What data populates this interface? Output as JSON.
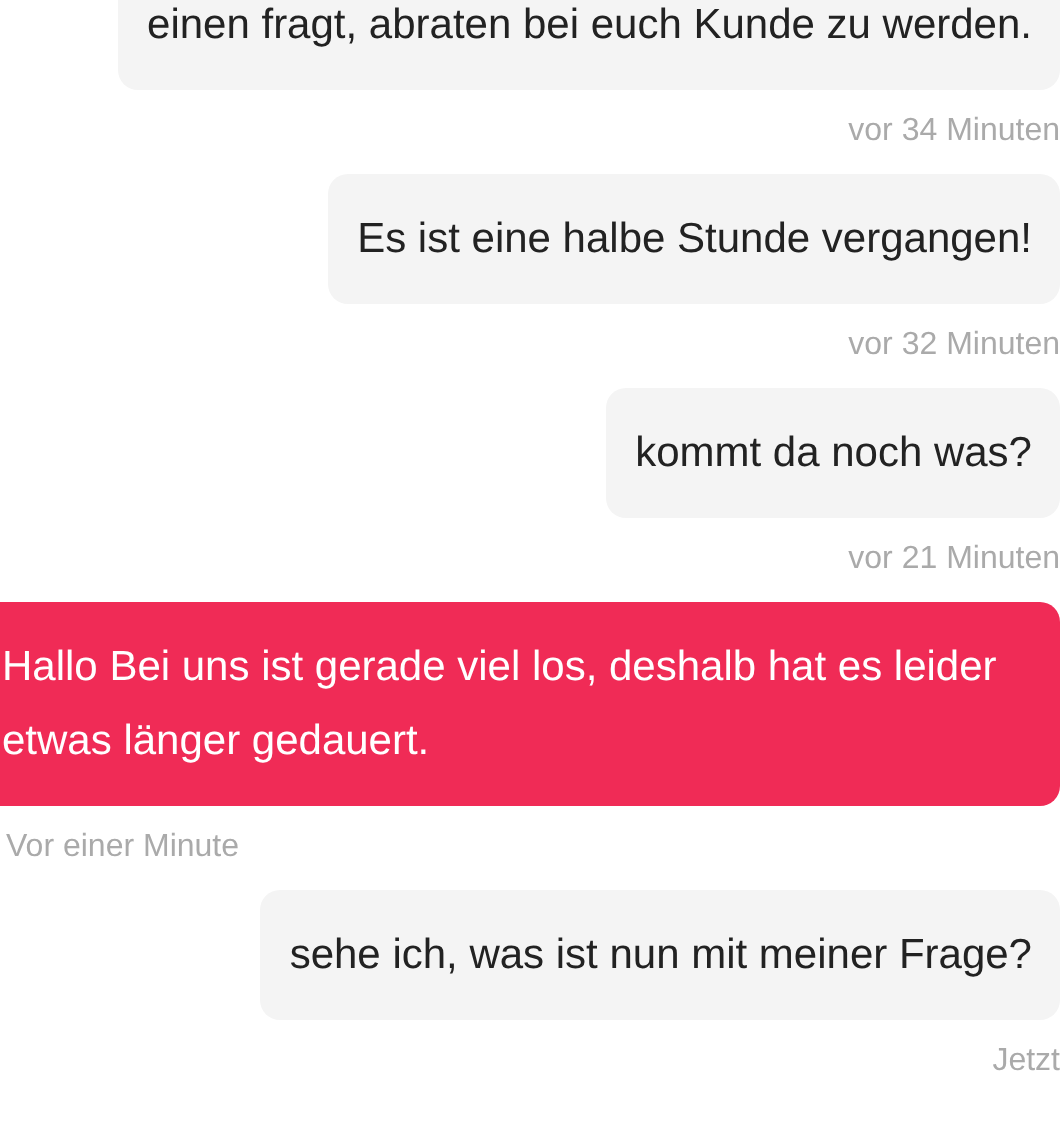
{
  "messages": [
    {
      "kind": "sent",
      "text": "einen fragt, abraten bei euch Kunde zu werden.",
      "time": "vor 34 Minuten"
    },
    {
      "kind": "sent",
      "text": "Es ist eine halbe Stunde vergangen!",
      "time": "vor 32 Minuten"
    },
    {
      "kind": "sent",
      "text": "kommt da noch was?",
      "time": "vor 21 Minuten"
    },
    {
      "kind": "received",
      "text": "Hallo Bei uns ist gerade viel los, deshalb hat es leider etwas länger gedauert.",
      "time": "Vor einer Minute"
    },
    {
      "kind": "sent",
      "text": "sehe ich, was ist nun mit meiner Frage?",
      "time": "Jetzt"
    }
  ]
}
